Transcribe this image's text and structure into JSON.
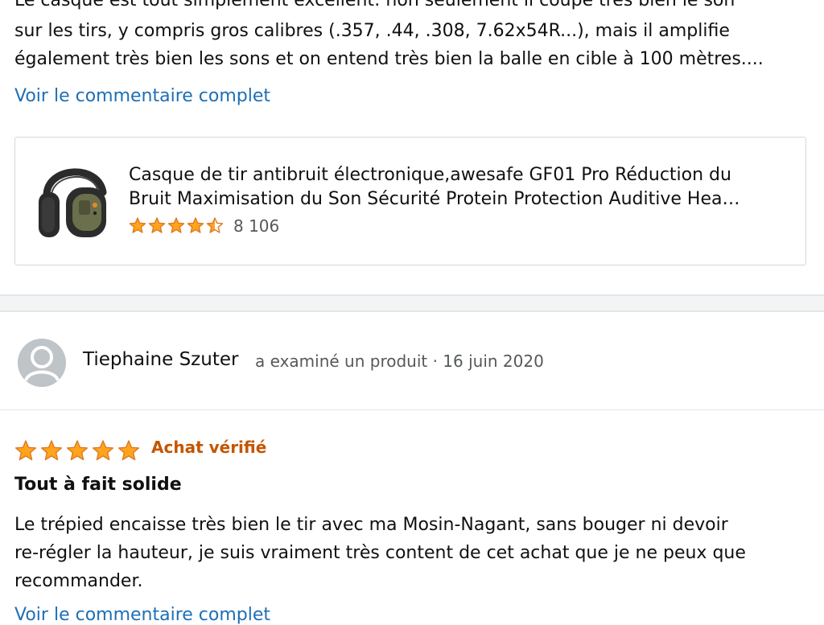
{
  "prev_review": {
    "lines": [
      "Le casque est tout simplement excellent: non seulement il coupe très bien le son",
      "sur les tirs, y compris gros calibres (.357, .44, .308, 7.62x54R...), mais il amplifie",
      "également très bien les sons et on entend très bien la balle en cible à 100 mètres...."
    ],
    "read_more": "Voir le commentaire complet"
  },
  "product": {
    "title_line1": "Casque de tir antibruit électronique,awesafe GF01 Pro Réduction du",
    "title_line2": "Bruit Maximisation du Son Sécurité Protein Protection Auditive Hea…",
    "rating": 4.5,
    "rating_count": "8 106",
    "image_icon": "earmuff-headset-image"
  },
  "review": {
    "author": "Tiephaine Szuter",
    "meta": "a examiné un produit · 16 juin 2020",
    "rating": 5,
    "badge": "Achat vérifié",
    "title": "Tout à fait solide",
    "lines": [
      "Le trépied encaisse très bien le tir avec ma Mosin-Nagant, sans bouger ni devoir",
      "re-régler la hauteur, je suis vraiment très content de cet achat que je ne peux que",
      "recommander."
    ],
    "read_more": "Voir le commentaire complet"
  },
  "colors": {
    "link": "#1e6fb5",
    "star": "#ffa41c",
    "star_outline": "#de7921",
    "verified": "#c45500",
    "separator": "#e7e9ec"
  }
}
